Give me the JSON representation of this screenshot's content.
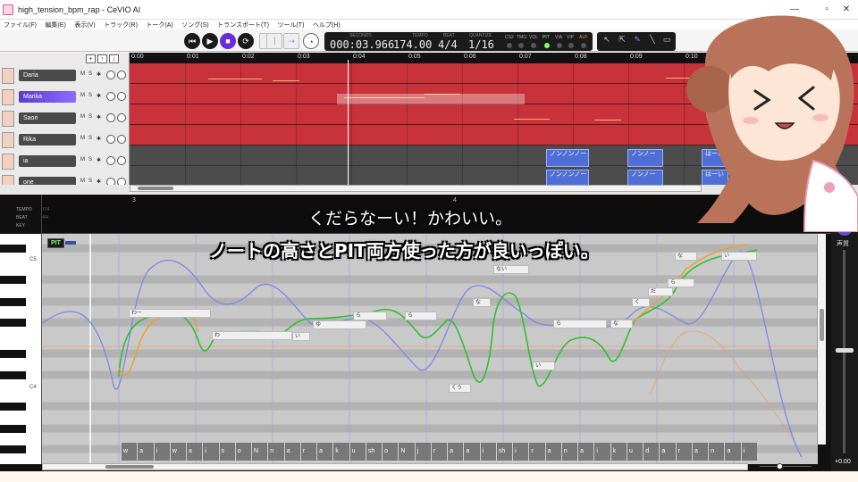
{
  "window": {
    "title": "high_tension_bpm_rap - CeVIO AI",
    "controls": [
      "—",
      "▫",
      "✕"
    ]
  },
  "menu": [
    "ファイル(F)",
    "編集(E)",
    "表示(V)",
    "トラック(R)",
    "トーク(A)",
    "ソング(S)",
    "トランスポート(T)",
    "ツール(T)",
    "ヘルプ(H)"
  ],
  "transport": {
    "seconds_label": "SECONDS",
    "seconds": "000:03.966",
    "tempo_label": "TEMPO",
    "tempo": "174.00",
    "beat_label": "BEAT",
    "beat": "4/4",
    "quantize_label": "QUANTIZE",
    "quantize": "1/16",
    "modes": [
      "CS2",
      "TMG",
      "VOL",
      "PIT",
      "VIA",
      "VIP",
      "ALP"
    ],
    "active_mode": "PIT"
  },
  "tracks": {
    "ops": [
      "+",
      "↑",
      "↓"
    ],
    "items": [
      {
        "name": "Daria",
        "mute": "M",
        "solo": "S"
      },
      {
        "name": "Marika",
        "mute": "M",
        "solo": "S"
      },
      {
        "name": "Saori",
        "mute": "M",
        "solo": "S"
      },
      {
        "name": "Rika",
        "mute": "M",
        "solo": "S"
      },
      {
        "name": "ia",
        "mute": "M",
        "solo": "S"
      },
      {
        "name": "one",
        "mute": "M",
        "solo": "S"
      }
    ],
    "ruler": [
      "0:00",
      "0:01",
      "0:02",
      "0:03",
      "0:04",
      "0:05",
      "0:06",
      "0:07",
      "0:08",
      "0:09",
      "0:10"
    ],
    "blocks": [
      "ノンノンノー",
      "ノンノー",
      "はーい",
      "ノンノンノー",
      "ノンノー",
      "はーい"
    ]
  },
  "editor": {
    "info_labels": [
      "TEMPO",
      "BEAT",
      "KEY"
    ],
    "tempo_small": "174",
    "beat_small": "4/4",
    "bars": [
      "3",
      "4"
    ],
    "key_labels": [
      "C5",
      "C4"
    ],
    "mode_badge": "PIT",
    "notes": [
      "わー",
      "わ",
      "い",
      "ゆ",
      "ない",
      "な",
      "ら",
      "ら",
      "くう",
      "い",
      "ら",
      "な",
      "く",
      "だ",
      "ら",
      "な",
      "い"
    ],
    "phonemes": [
      "w",
      "a",
      "i",
      "w",
      "a",
      "i",
      "s",
      "o",
      "N",
      "n",
      "a",
      "r",
      "a",
      "k",
      "u",
      "sh",
      "o",
      "N",
      "j",
      "r",
      "a",
      "a",
      "i",
      "sh",
      "i",
      "r",
      "a",
      "n",
      "a",
      "i",
      "k",
      "u",
      "d",
      "a",
      "r",
      "a",
      "n",
      "a",
      "i"
    ]
  },
  "param_panel": {
    "label": "声質",
    "value": "+0.00"
  },
  "captions": {
    "line1": "くだらなーい！かわいい。",
    "line2": "ノートの高さとPIT両方使った方が良いっぽい。"
  },
  "colors": {
    "track_red": "#c8323b",
    "block_blue": "#4f6fd6",
    "pitch_green": "#2fbf2f",
    "pitch_orange": "#f0a020",
    "pitch_blue": "#7b88e8",
    "accent_purple": "#6a2bd8"
  }
}
